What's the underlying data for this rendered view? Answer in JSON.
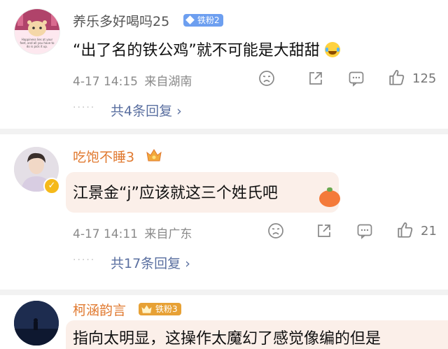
{
  "comments": [
    {
      "username": "养乐多好喝吗25",
      "badge": "铁粉2",
      "avatar_caption": "Happiness lies at your feet, and all you have to do is pick it up.",
      "text": "“出了名的铁公鸡”就不可能是大甜甜",
      "emoji": "laughing-crying-emoji",
      "date": "4-17",
      "time": "14:15",
      "location": "来自湖南",
      "like_count": "125",
      "replies_dots": "·····",
      "replies": "共4条回复 ›"
    },
    {
      "username": "吃饱不睡3",
      "text": "江景金“j”应该就这三个姓氏吧",
      "emoji": "persimmon-emoji",
      "date": "4-17",
      "time": "14:11",
      "location": "来自广东",
      "like_count": "21",
      "replies_dots": "·····",
      "replies": "共17条回复 ›"
    },
    {
      "username": "柯涵韵言",
      "badge": "铁粉3",
      "text": "指向太明显，这操作太魔幻了感觉像编的但是"
    }
  ],
  "colors": {
    "username": "#e0792f",
    "username_first": "#555555",
    "badge_blue": "#6d9ff0",
    "badge_gold": "#e7a135",
    "link": "#5a6fa0"
  },
  "icons": [
    "sad-face-icon",
    "share-icon",
    "comment-icon",
    "like-icon",
    "vip-crown-icon",
    "verified-badge-icon"
  ]
}
